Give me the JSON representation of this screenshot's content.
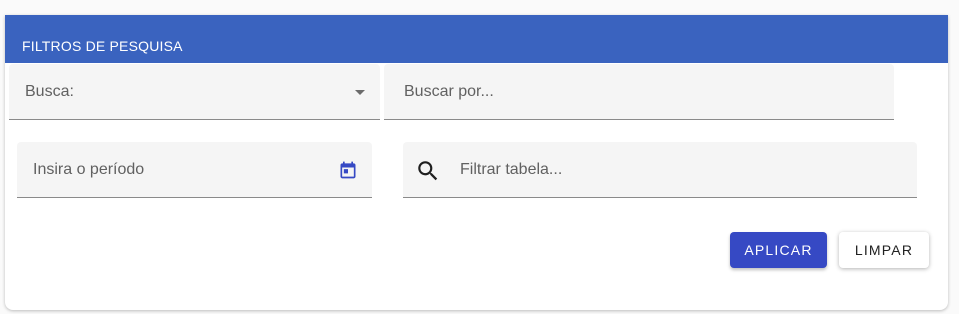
{
  "colors": {
    "header_background": "#3a63bf",
    "apply_button": "#3649c4",
    "field_background": "#f5f5f5",
    "calendar_icon": "#3649c4"
  },
  "panel": {
    "title": "FILTROS DE PESQUISA"
  },
  "filters": {
    "search_type": {
      "label": "Busca:",
      "icon": "chevron-down-icon"
    },
    "search_by": {
      "placeholder": "Buscar por..."
    },
    "period": {
      "placeholder": "Insira o período",
      "icon": "calendar-icon"
    },
    "table_filter": {
      "placeholder": "Filtrar tabela...",
      "icon": "search-icon"
    }
  },
  "actions": {
    "apply_label": "APLICAR",
    "clear_label": "LIMPAR"
  }
}
